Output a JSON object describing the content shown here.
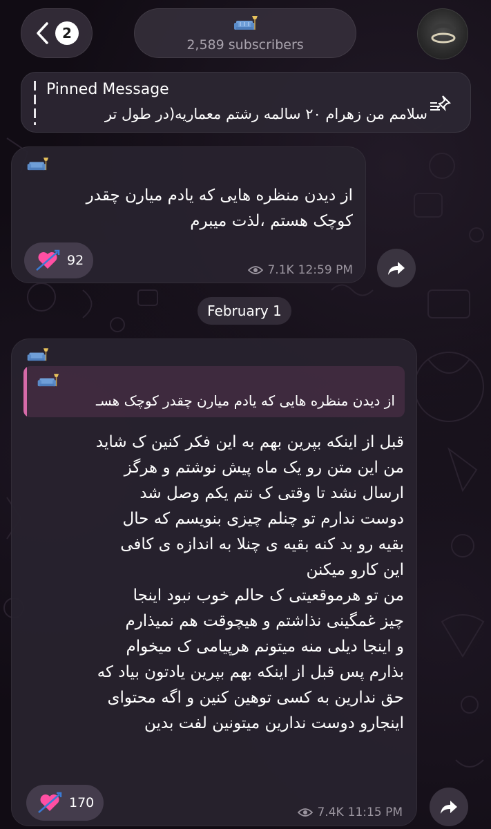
{
  "header": {
    "back_badge": "2",
    "subscribers": "2,589 subscribers"
  },
  "pinned": {
    "title": "Pinned Message",
    "text": "سلامم من زهرام ۲۰ سالمه رشتم معماریه(در طول تر"
  },
  "messages": [
    {
      "text_lines": [
        "از دیدن منظره هایی که یادم میارن چقدر",
        "کوچک هستم ،لذت میبرم"
      ],
      "reaction_count": "92",
      "views": "7.1K",
      "time": "12:59 PM"
    },
    {
      "reply_text": "از دیدن منظره هایی که یادم میارن چقدر کوچک هسـ",
      "text_lines": [
        "قبل از اینکه بپرین بهم به این فکر کنین ک شاید",
        "من این متن رو یک ماه پیش نوشتم و هرگز",
        "ارسال نشد تا وقتی ک نتم یکم وصل شد",
        "دوست ندارم تو چنلم چیزی بنویسم که حال",
        "بقیه رو بد کنه بقیه ی چنلا به اندازه ی کافی",
        "این کارو میکنن",
        "من تو هرموقعیتی ک حالم خوب نبود اینجا",
        "چیز غمگینی نذاشتم و هیچوقت هم نمیذارم",
        "و اینجا دیلی منه میتونم هرپیامی ک میخوام",
        "بذارم پس قبل از اینکه بهم بپرین یادتون بیاد که",
        "حق ندارین به کسی توهین کنین و اگه محتوای",
        "اینجارو دوست ندارین میتونین لفت بدین"
      ],
      "reaction_count": "170",
      "views": "7.4K",
      "time": "11:15 PM"
    }
  ],
  "date_divider": "February 1",
  "icons": {
    "back": "chevron-left-icon",
    "channel": "sofa-icon",
    "pin": "pin-list-icon",
    "reaction": "heart-arrow-icon",
    "views": "eye-icon",
    "share": "share-arrow-icon"
  },
  "colors": {
    "background": "#120d15",
    "bubble": "#28222e",
    "quote_accent": "#d66aa8",
    "meta_text": "#9c96a0"
  }
}
